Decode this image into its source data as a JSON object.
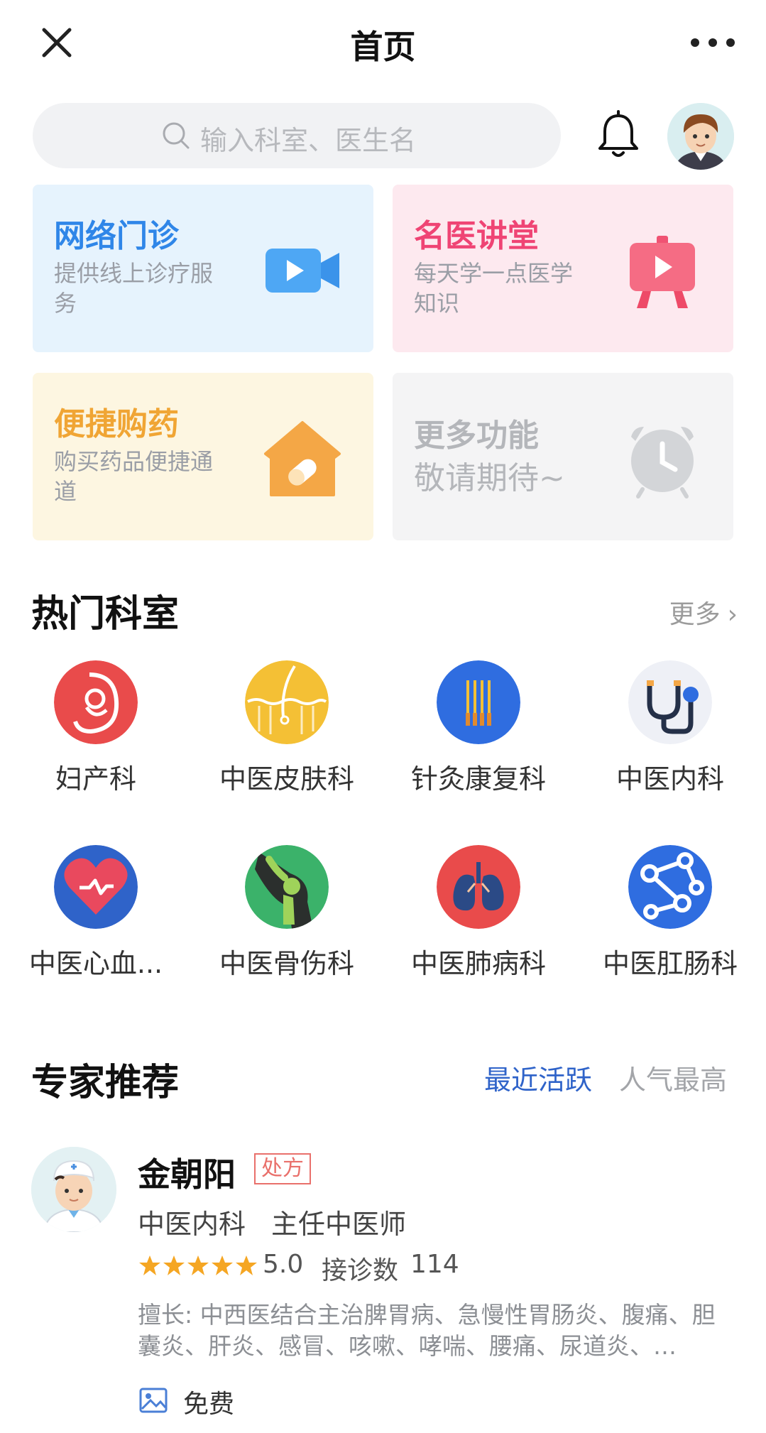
{
  "header": {
    "title": "首页"
  },
  "search": {
    "placeholder": "输入科室、医生名"
  },
  "cards": [
    {
      "title": "网络门诊",
      "desc": "提供线上诊疗服务",
      "icon": "video-camera-icon"
    },
    {
      "title": "名医讲堂",
      "desc": "每天学一点医学知识",
      "icon": "lecture-board-icon"
    },
    {
      "title": "便捷购药",
      "desc": "购买药品便捷通道",
      "icon": "pharmacy-house-icon"
    },
    {
      "title": "更多功能",
      "desc": "敬请期待~",
      "icon": "alarm-clock-icon"
    }
  ],
  "departments": {
    "title": "热门科室",
    "more_label": "更多",
    "items": [
      {
        "label": "妇产科",
        "icon": "obstetrics-icon",
        "color": "#e94b4b"
      },
      {
        "label": "中医皮肤科",
        "icon": "skin-hair-icon",
        "color": "#f4c035"
      },
      {
        "label": "针灸康复科",
        "icon": "acupuncture-needles-icon",
        "color": "#2f6de0"
      },
      {
        "label": "中医内科",
        "icon": "stethoscope-icon",
        "color": "#eef0f6"
      },
      {
        "label": "中医心血...",
        "icon": "heart-icon",
        "color": "#2f63c9"
      },
      {
        "label": "中医骨伤科",
        "icon": "knee-bone-icon",
        "color": "#3bb26a"
      },
      {
        "label": "中医肺病科",
        "icon": "lungs-icon",
        "color": "#e94b4b"
      },
      {
        "label": "中医肛肠科",
        "icon": "intestine-nodes-icon",
        "color": "#2f6de0"
      }
    ]
  },
  "experts": {
    "title": "专家推荐",
    "tabs": [
      "最近活跃",
      "人气最高"
    ],
    "doctor": {
      "name": "金朝阳",
      "badge": "处方",
      "department": "中医内科",
      "position": "主任中医师",
      "rating": "5.0",
      "rating_stars": 5,
      "consult_label": "接诊数",
      "consult_count": "114",
      "skill": "擅长: 中西医结合主治脾胃病、急慢性胃肠炎、腹痛、胆囊炎、肝炎、感冒、咳嗽、哮喘、腰痛、尿道炎、…",
      "service": "免费"
    }
  },
  "colors": {
    "accent_blue": "#2f63c9",
    "pink": "#ef4474",
    "orange": "#f0a534",
    "muted": "#a3a5a9"
  }
}
